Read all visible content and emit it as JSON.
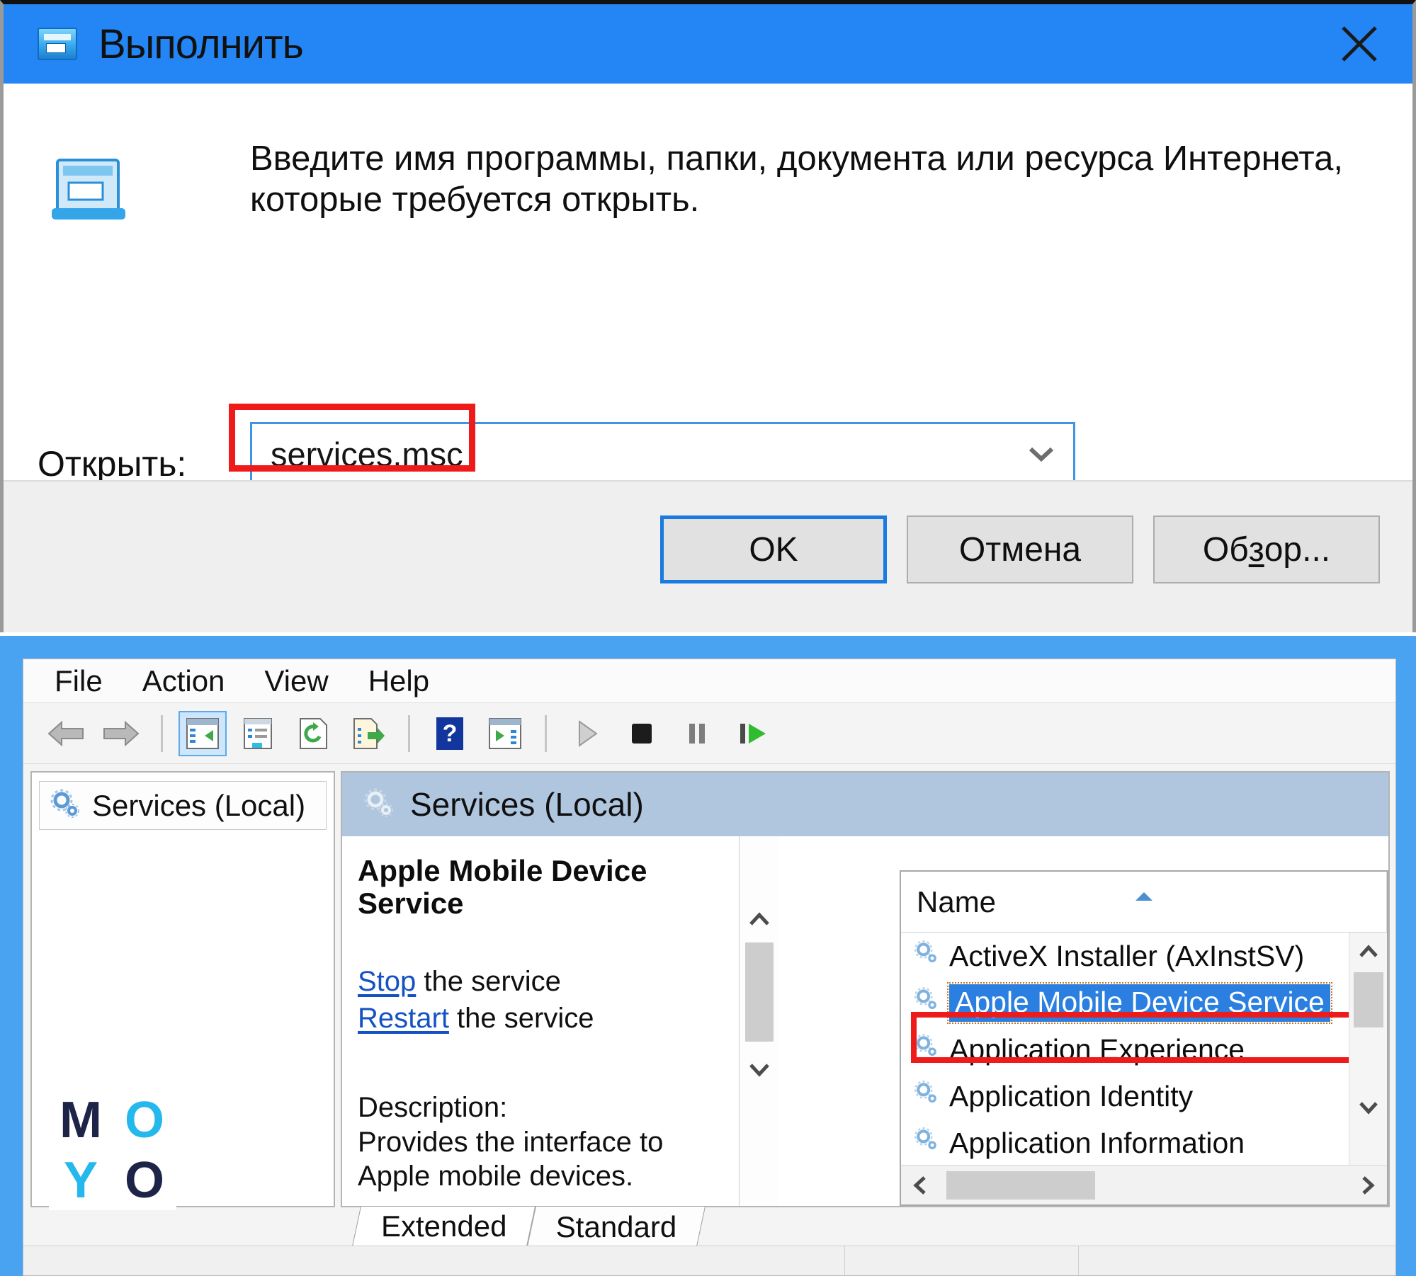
{
  "run_dialog": {
    "title": "Выполнить",
    "title_icon": "run-app-icon",
    "close_icon": "close-icon",
    "prompt": "Введите имя программы, папки, документа или ресурса Интернета, которые требуется открыть.",
    "open_label_prefix": "О",
    "open_label_rest": "ткрыть:",
    "input_value": "services.msc",
    "input_placeholder": "",
    "dropdown_icon": "chevron-down-icon",
    "buttons": {
      "ok": "OK",
      "cancel": "Отмена",
      "browse_prefix": "Об",
      "browse_accel": "з",
      "browse_suffix": "ор..."
    },
    "highlight_color": "#ef1b1b",
    "accent_color": "#2485f5"
  },
  "services_window": {
    "menu": [
      "File",
      "Action",
      "View",
      "Help"
    ],
    "toolbar": [
      {
        "name": "back-arrow-icon",
        "active": false
      },
      {
        "name": "forward-arrow-icon",
        "active": false
      },
      {
        "name": "separator",
        "active": false
      },
      {
        "name": "show-console-tree-icon",
        "active": true
      },
      {
        "name": "properties-icon",
        "active": false
      },
      {
        "name": "refresh-icon",
        "active": false
      },
      {
        "name": "export-list-icon",
        "active": false
      },
      {
        "name": "separator",
        "active": false
      },
      {
        "name": "help-icon",
        "active": false
      },
      {
        "name": "show-action-pane-icon",
        "active": false
      },
      {
        "name": "separator",
        "active": false
      },
      {
        "name": "start-service-icon",
        "active": false
      },
      {
        "name": "stop-service-icon",
        "active": false
      },
      {
        "name": "pause-service-icon",
        "active": false
      },
      {
        "name": "restart-service-icon",
        "active": false
      }
    ],
    "tree": {
      "root_label": "Services (Local)",
      "root_icon": "gear-icon"
    },
    "details": {
      "header": "Services (Local)",
      "header_icon": "gear-icon",
      "service_name": "Apple Mobile Device Service",
      "action_stop_link": "Stop",
      "action_stop_rest": " the service",
      "action_restart_link": "Restart",
      "action_restart_rest": " the service",
      "description_label": "Description:",
      "description_text": "Provides the interface to Apple mobile devices."
    },
    "list": {
      "column_header": "Name",
      "sort_icon": "sort-ascending-icon",
      "rows": [
        {
          "label": "ActiveX Installer (AxInstSV)",
          "icon": "gear-icon",
          "selected": false
        },
        {
          "label": "Apple Mobile Device Service",
          "icon": "gear-icon",
          "selected": true
        },
        {
          "label": "Application Experience",
          "icon": "gear-icon",
          "selected": false
        },
        {
          "label": "Application Identity",
          "icon": "gear-icon",
          "selected": false
        },
        {
          "label": "Application Information",
          "icon": "gear-icon",
          "selected": false
        }
      ],
      "highlight_color": "#ef1b1b",
      "selection_color": "#2a7fe0"
    },
    "tabs": [
      {
        "label": "Extended",
        "active": true
      },
      {
        "label": "Standard",
        "active": false
      }
    ],
    "frame_color": "#4aa3f0"
  },
  "watermark": {
    "letters": [
      {
        "char": "M",
        "color": "dark"
      },
      {
        "char": "O",
        "color": "cyan"
      },
      {
        "char": "Y",
        "color": "cyan"
      },
      {
        "char": "O",
        "color": "dark"
      }
    ]
  }
}
